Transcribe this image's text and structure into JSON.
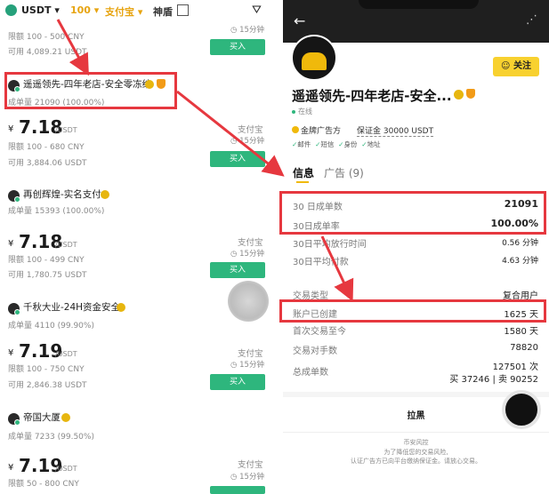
{
  "left": {
    "topbar": {
      "currency": "USDT",
      "amount": "100",
      "payment": "支付宝",
      "shendun": "神盾"
    },
    "partial_top": {
      "limit": "限额 100 - 500 CNY",
      "available": "可用 4,089.21 USDT",
      "time": "15分钟",
      "buy": "买入"
    },
    "merchants": [
      {
        "name": "遥遥领先-四年老店-安全零冻结",
        "stats": "成单量 21090 (100.00%)",
        "yen": "¥",
        "price": "7.18",
        "unit": "/USDT",
        "limit": "限额 100 - 680 CNY",
        "available": "可用 3,884.06 USDT",
        "pay": "支付宝",
        "time": "15分钟",
        "buy": "买入"
      },
      {
        "name": "再创辉煌-实名支付",
        "stats": "成单量 15393 (100.00%)",
        "yen": "¥",
        "price": "7.18",
        "unit": "/USDT",
        "limit": "限额 100 - 499 CNY",
        "available": "可用 1,780.75 USDT",
        "pay": "支付宝",
        "time": "15分钟",
        "buy": "买入"
      },
      {
        "name": "千秋大业-24H资金安全",
        "stats": "成单量 4110 (99.90%)",
        "yen": "¥",
        "price": "7.19",
        "unit": "/USDT",
        "limit": "限额 100 - 750 CNY",
        "available": "可用 2,846.38 USDT",
        "pay": "支付宝",
        "time": "15分钟",
        "buy": "买入"
      },
      {
        "name": "帝国大厦",
        "stats": "成单量 7233 (99.50%)",
        "yen": "¥",
        "price": "7.19",
        "unit": "/USDT",
        "limit": "限额 50 - 800 CNY",
        "available": "",
        "pay": "支付宝",
        "time": "15分钟",
        "buy": ""
      }
    ]
  },
  "right": {
    "back": "←",
    "follow": "关注",
    "name": "遥遥领先-四年老店-安全...",
    "online": "在线",
    "gold_merchant": "金牌广告方",
    "deposit": "保证金 30000 USDT",
    "verify": [
      "邮件",
      "短信",
      "身份",
      "地址"
    ],
    "tabs": {
      "info": "信息",
      "ads": "广告 (9)"
    },
    "stats": [
      {
        "label": "30 日成单数",
        "value": "21091",
        "bold": true
      },
      {
        "label": "30日成单率",
        "value": "100.00%",
        "bold": true
      },
      {
        "label": "30日平均放行时间",
        "value": "0.56 分钟",
        "bold": false
      },
      {
        "label": "30日平均付款",
        "value": "4.63 分钟",
        "bold": false
      }
    ],
    "details": [
      {
        "label": "交易类型",
        "value": "复合用户"
      },
      {
        "label": "账户已创建",
        "value": "1625 天"
      },
      {
        "label": "首次交易至今",
        "value": "1580 天"
      },
      {
        "label": "交易对手数",
        "value": "78820"
      },
      {
        "label": "总成单数",
        "value": "127501 次"
      }
    ],
    "buy_sell": "买 37246 | 卖 90252",
    "blacklist": "拉黑",
    "risk_title": "币安风控",
    "risk_text_1": "为了降低您的交易风险,",
    "risk_text_2": "认证广告方已向平台缴纳保证金。请放心交易。"
  },
  "colors": {
    "accent_green": "#2eb67d",
    "brand_yellow": "#f0b90b",
    "highlight_red": "#e6383f"
  }
}
